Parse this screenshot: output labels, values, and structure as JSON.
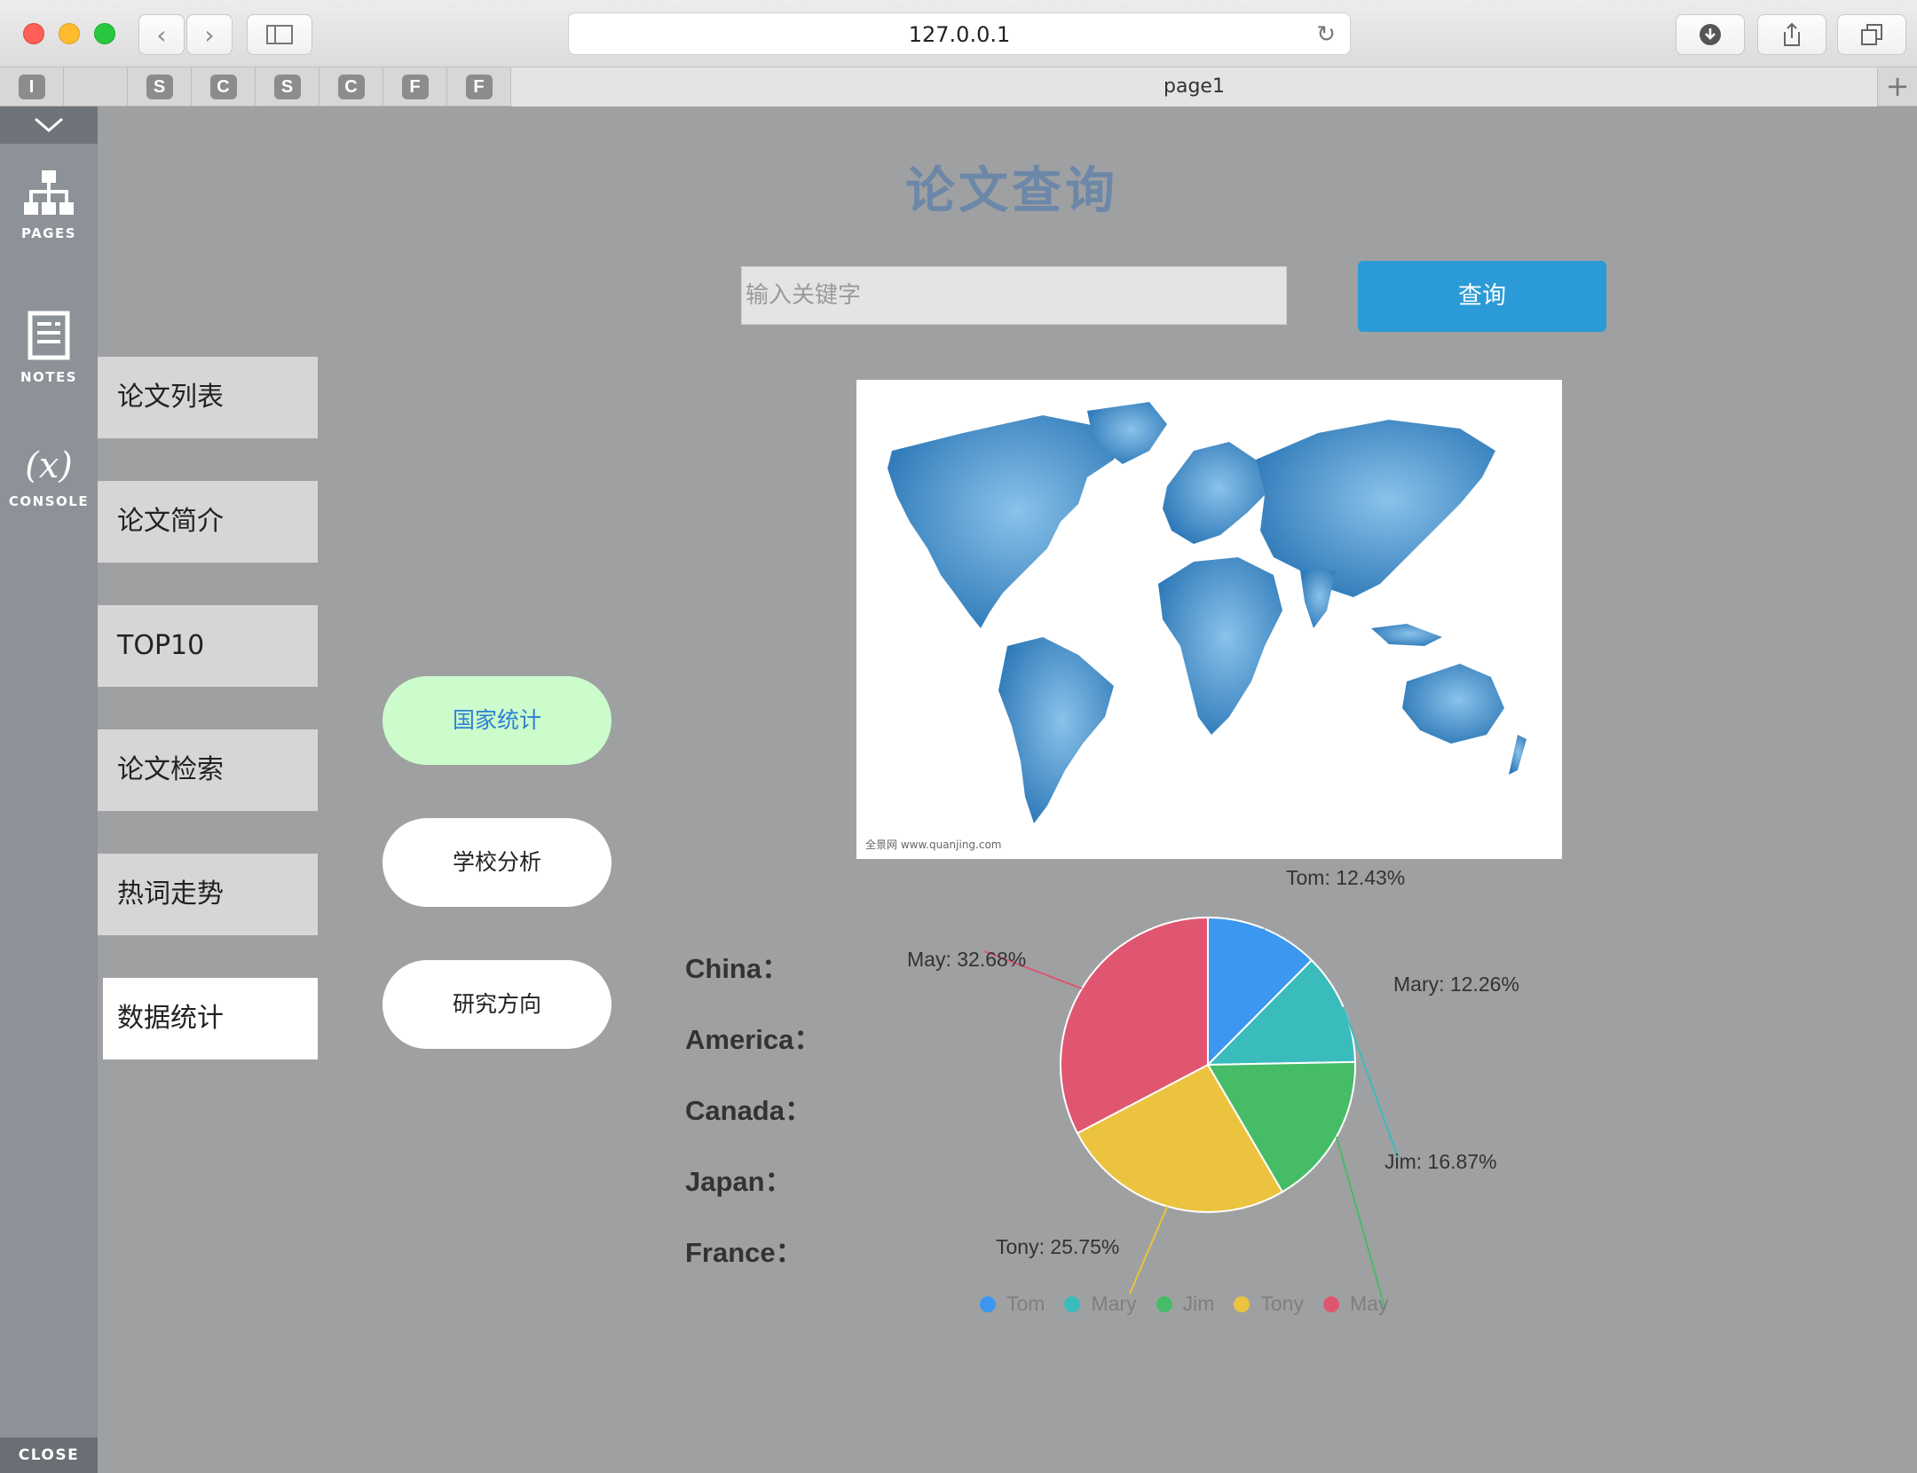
{
  "browser": {
    "url": "127.0.0.1",
    "tabs_small": [
      "I",
      "",
      "S",
      "C",
      "S",
      "C",
      "F",
      "F"
    ],
    "page_tab": "page1",
    "add_tab": "+"
  },
  "toolbar": {
    "pages_label": "PAGES",
    "notes_label": "NOTES",
    "console_label": "CONSOLE",
    "console_glyph": "(x)",
    "close_label": "CLOSE"
  },
  "header": {
    "title": "论文查询",
    "search_placeholder": "输入关键字",
    "search_button": "查询"
  },
  "nav": {
    "items": [
      "论文列表",
      "论文简介",
      "TOP10",
      "论文检索",
      "热词走势",
      "数据统计"
    ],
    "active_index": 5
  },
  "subnav": {
    "items": [
      "国家统计",
      "学校分析",
      "研究方向"
    ],
    "active_index": 0
  },
  "map": {
    "credit": "全景网 www.quanjing.com"
  },
  "countries": [
    "China：",
    "America：",
    "Canada：",
    "Japan：",
    "France："
  ],
  "chart_data": {
    "type": "pie",
    "series": [
      {
        "name": "Tom",
        "value": 12.43,
        "color": "#3b97ef"
      },
      {
        "name": "Mary",
        "value": 12.26,
        "color": "#3abcbd"
      },
      {
        "name": "Jim",
        "value": 16.87,
        "color": "#46bc67"
      },
      {
        "name": "Tony",
        "value": 25.75,
        "color": "#ebc33e"
      },
      {
        "name": "May",
        "value": 32.68,
        "color": "#e05670"
      }
    ],
    "labels": [
      "Tom: 12.43%",
      "Mary: 12.26%",
      "Jim: 16.87%",
      "Tony: 25.75%",
      "May: 32.68%"
    ],
    "legend_placement": "bottom"
  }
}
